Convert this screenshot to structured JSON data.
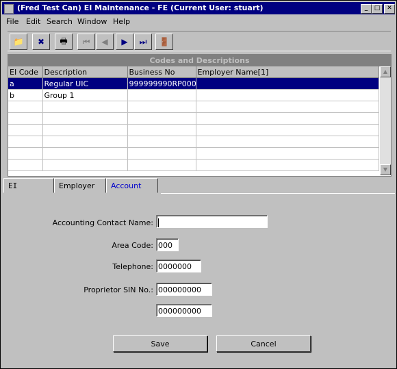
{
  "window": {
    "title": "(Fred Test Can) EI Maintenance - FE (Current User: stuart)"
  },
  "title_buttons": {
    "minimize": "_",
    "maximize": "□",
    "close": "✕"
  },
  "menu": [
    {
      "label": "File"
    },
    {
      "label": "Edit"
    },
    {
      "label": "Search"
    },
    {
      "label": "Window"
    },
    {
      "label": "Help"
    }
  ],
  "toolbar": [
    {
      "icon": "new-folder-icon",
      "glyph": "📁",
      "enabled": true
    },
    {
      "icon": "delete-icon",
      "glyph": "✖",
      "enabled": true
    },
    {
      "icon": "print-icon",
      "glyph": "🖶",
      "enabled": true
    },
    {
      "icon": "first-record-icon",
      "glyph": "⏮",
      "enabled": false
    },
    {
      "icon": "previous-record-icon",
      "glyph": "◀",
      "enabled": false
    },
    {
      "icon": "next-record-icon",
      "glyph": "▶",
      "enabled": true
    },
    {
      "icon": "last-record-icon",
      "glyph": "⏭",
      "enabled": true
    },
    {
      "icon": "exit-icon",
      "glyph": "🚪",
      "enabled": true
    }
  ],
  "grid": {
    "title": "Codes and Descriptions",
    "columns": [
      "EI Code",
      "Description",
      "Business No",
      "Employer Name[1]"
    ],
    "rows": [
      [
        "a",
        "Regular UIC",
        "999999990RP000",
        ""
      ],
      [
        "b",
        "Group 1",
        "",
        ""
      ],
      [
        "",
        "",
        "",
        ""
      ],
      [
        "",
        "",
        "",
        ""
      ],
      [
        "",
        "",
        "",
        ""
      ],
      [
        "",
        "",
        "",
        ""
      ],
      [
        "",
        "",
        "",
        ""
      ],
      [
        "",
        "",
        "",
        ""
      ]
    ]
  },
  "tabs": [
    {
      "label": "EI",
      "active": false
    },
    {
      "label": "Employer",
      "active": false
    },
    {
      "label": "Account",
      "active": true
    }
  ],
  "form": {
    "accounting_contact_label": "Accounting Contact Name:",
    "accounting_contact_value": "",
    "area_code_label": "Area Code:",
    "area_code_value": "000",
    "telephone_label": "Telephone:",
    "telephone_value": "0000000",
    "proprietor_sin_label": "Proprietor SIN No.:",
    "proprietor_sin_value_1": "000000000",
    "proprietor_sin_value_2": "000000000"
  },
  "buttons": {
    "save": "Save",
    "cancel": "Cancel"
  },
  "colors": {
    "titlebar": "#000080",
    "selection": "#000080",
    "active_tab_text": "#0000cc"
  }
}
